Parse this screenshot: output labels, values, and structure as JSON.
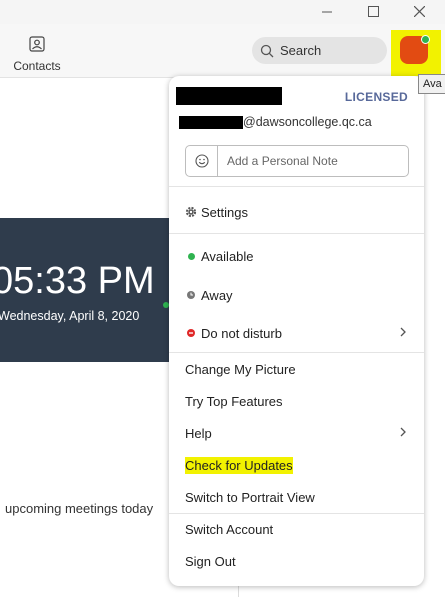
{
  "nav": {
    "contacts_label": "Contacts"
  },
  "search": {
    "label": "Search"
  },
  "tooltip": {
    "text": "Ava"
  },
  "background": {
    "time": "05:33 PM",
    "date": "Wednesday, April 8, 2020",
    "upcoming": "upcoming meetings today"
  },
  "profile": {
    "license": "LICENSED",
    "email_domain": "@dawsoncollege.qc.ca",
    "note_placeholder": "Add a Personal Note"
  },
  "menu": {
    "settings": "Settings",
    "available": "Available",
    "away": "Away",
    "dnd": "Do not disturb",
    "change_picture": "Change My Picture",
    "top_features": "Try Top Features",
    "help": "Help",
    "check_updates": "Check for Updates",
    "portrait": "Switch to Portrait View",
    "switch_account": "Switch Account",
    "sign_out": "Sign Out"
  },
  "colors": {
    "highlight": "#f2f200",
    "available": "#2fb350",
    "dnd": "#e02828",
    "licensed": "#58699a",
    "avatar": "#e24b12"
  }
}
